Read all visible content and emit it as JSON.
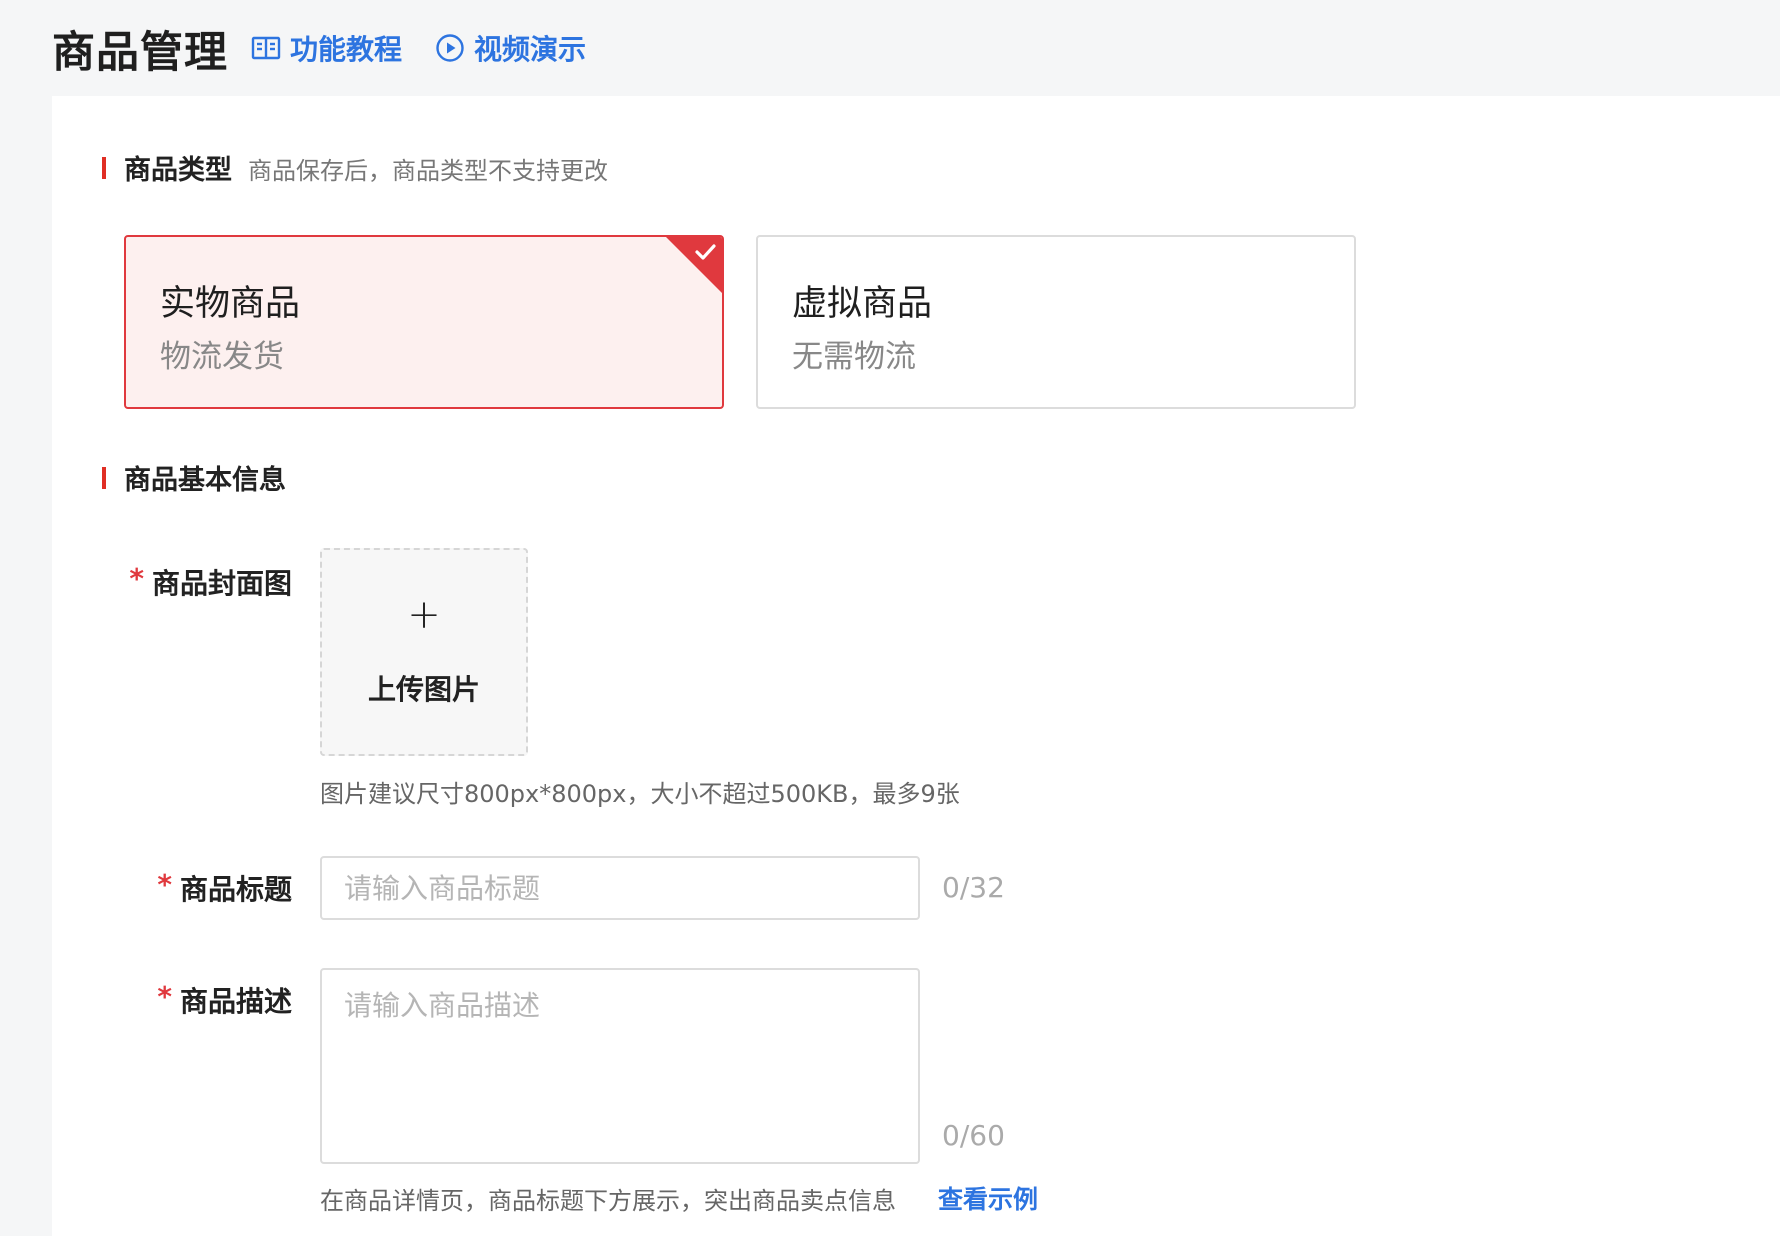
{
  "header": {
    "title": "商品管理",
    "tutorial_label": "功能教程",
    "video_label": "视频演示"
  },
  "product_type": {
    "title": "商品类型",
    "note": "商品保存后，商品类型不支持更改",
    "options": [
      {
        "name": "实物商品",
        "desc": "物流发货",
        "selected": true
      },
      {
        "name": "虚拟商品",
        "desc": "无需物流",
        "selected": false
      }
    ]
  },
  "basic_info": {
    "title": "商品基本信息",
    "required_mark": "*",
    "cover": {
      "label": "商品封面图",
      "upload_plus": "+",
      "upload_text": "上传图片",
      "hint": "图片建议尺寸800px*800px，大小不超过500KB，最多9张"
    },
    "product_title": {
      "label": "商品标题",
      "placeholder": "请输入商品标题",
      "value": "",
      "counter": "0/32"
    },
    "description": {
      "label": "商品描述",
      "placeholder": "请输入商品描述",
      "value": "",
      "counter": "0/60",
      "hint": "在商品详情页，商品标题下方展示，突出商品卖点信息",
      "example_link": "查看示例"
    }
  },
  "colors": {
    "accent": "#e0393e",
    "link": "#2d74e0",
    "selected_bg": "#fdf0ef"
  }
}
